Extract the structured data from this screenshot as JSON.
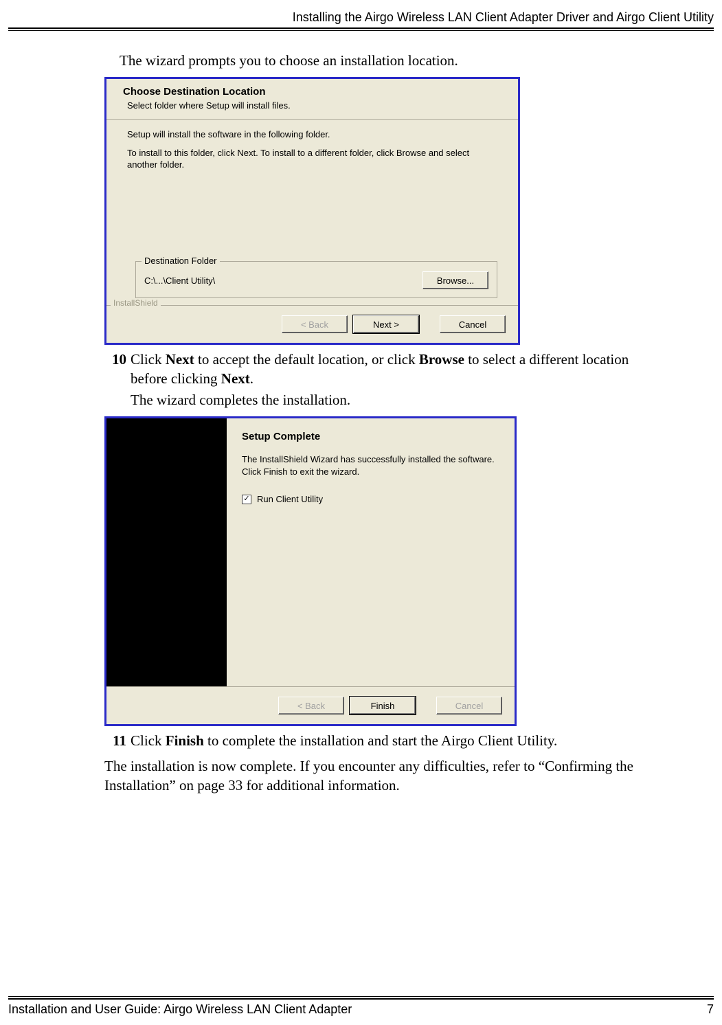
{
  "header": {
    "section_title": "Installing the Airgo Wireless LAN Client Adapter Driver and Airgo Client Utility"
  },
  "lead_text_1": "The wizard prompts you to choose an installation location.",
  "screenshot1": {
    "title": "Choose Destination Location",
    "subtitle": "Select folder where Setup will install files.",
    "line1": "Setup will install the software in the following folder.",
    "line2": "To install to this folder, click Next. To install to a different folder, click Browse and select another folder.",
    "group_label": "Destination Folder",
    "path": "C:\\...\\Client Utility\\",
    "browse_label": "Browse...",
    "installshield_label": "InstallShield",
    "back_label": "< Back",
    "next_label": "Next >",
    "cancel_label": "Cancel"
  },
  "step10": {
    "num": "10",
    "text_pre": "Click ",
    "bold1": "Next",
    "text_mid1": " to accept the default location, or click ",
    "bold2": "Browse",
    "text_mid2": " to select a different location before clicking ",
    "bold3": "Next",
    "text_end": ".",
    "follow": "The wizard completes the installation."
  },
  "screenshot2": {
    "title": "Setup Complete",
    "body": "The InstallShield Wizard has successfully installed the software.  Click Finish to exit the wizard.",
    "checkbox_label": "Run Client Utility",
    "back_label": "< Back",
    "finish_label": "Finish",
    "cancel_label": "Cancel"
  },
  "step11": {
    "num": "11",
    "text_pre": "Click ",
    "bold1": "Finish",
    "text_end": " to complete the installation and start the Airgo Client Utility."
  },
  "closing": "The installation is now complete. If you encounter any difficulties, refer to “Confirming the Installation” on page 33 for additional information.",
  "footer": {
    "doc_title": "Installation and User Guide: Airgo Wireless LAN Client Adapter",
    "page_number": "7"
  }
}
